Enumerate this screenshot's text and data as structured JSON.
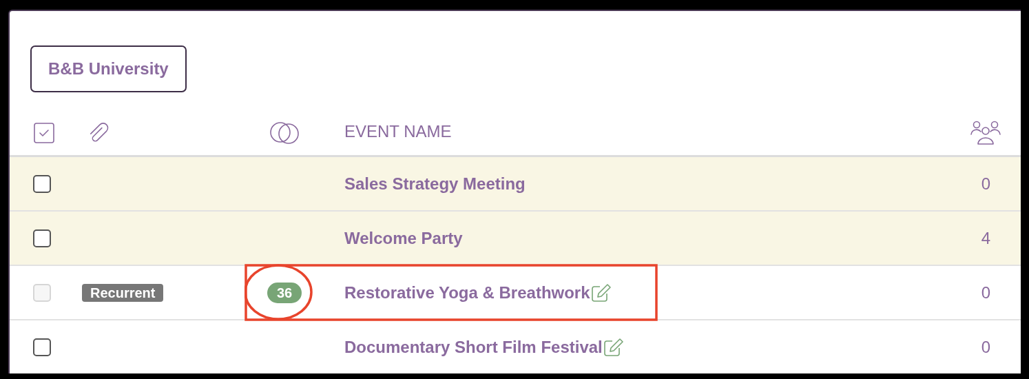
{
  "filter_button": {
    "label": "B&B University"
  },
  "table": {
    "columns": [
      {
        "kind": "select"
      },
      {
        "kind": "attachment"
      },
      {
        "kind": "group"
      },
      {
        "kind": "name",
        "label": "EVENT NAME"
      },
      {
        "kind": "attendees"
      }
    ],
    "rows": [
      {
        "checked": false,
        "disabled": false,
        "highlighted": true,
        "annotated": false,
        "tag": "",
        "count": "",
        "name": "Sales Strategy Meeting",
        "editable": false,
        "attendees": "0"
      },
      {
        "checked": false,
        "disabled": false,
        "highlighted": true,
        "annotated": false,
        "tag": "",
        "count": "",
        "name": "Welcome Party",
        "editable": false,
        "attendees": "4"
      },
      {
        "checked": false,
        "disabled": true,
        "highlighted": false,
        "annotated": true,
        "tag": "Recurrent",
        "count": "36",
        "name": "Restorative Yoga & Breathwork",
        "editable": true,
        "attendees": "0"
      },
      {
        "checked": false,
        "disabled": false,
        "highlighted": false,
        "annotated": false,
        "tag": "",
        "count": "",
        "name": "Documentary Short Film Festival",
        "editable": true,
        "attendees": "0"
      }
    ]
  }
}
